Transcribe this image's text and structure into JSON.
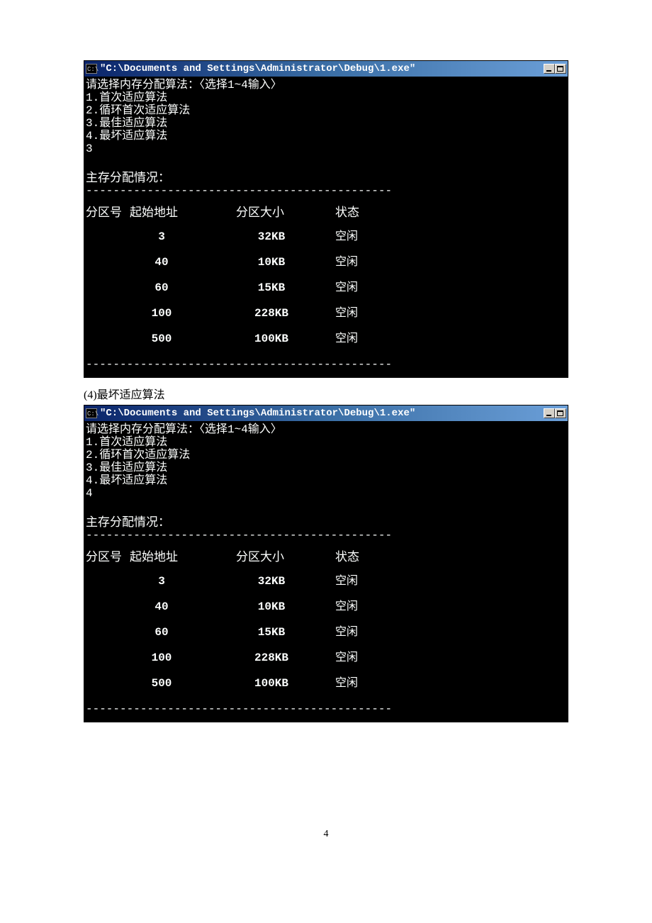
{
  "titlebar": {
    "icon_label": "C:\\",
    "title": "\"C:\\Documents and Settings\\Administrator\\Debug\\1.exe\""
  },
  "console1": {
    "prompt": "请选择内存分配算法：〈选择1~4输入〉",
    "opt1": "1.首次适应算法",
    "opt2": "2.循环首次适应算法",
    "opt3": "3.最佳适应算法",
    "opt4": "4.最坏适应算法",
    "input": "3",
    "section": "主存分配情况：",
    "hr": "---------------------------------------------",
    "headers": {
      "id": "分区号",
      "addr": "起始地址",
      "size": "分区大小",
      "state": "状态"
    },
    "rows": [
      {
        "id": "",
        "addr": "3",
        "size": "32KB",
        "state": "空闲"
      },
      {
        "id": "",
        "addr": "40",
        "size": "10KB",
        "state": "空闲"
      },
      {
        "id": "",
        "addr": "60",
        "size": "15KB",
        "state": "空闲"
      },
      {
        "id": "",
        "addr": "100",
        "size": "228KB",
        "state": "空闲"
      },
      {
        "id": "",
        "addr": "500",
        "size": "100KB",
        "state": "空闲"
      }
    ]
  },
  "caption": "(4)最坏适应算法",
  "console2": {
    "prompt": "请选择内存分配算法：〈选择1~4输入〉",
    "opt1": "1.首次适应算法",
    "opt2": "2.循环首次适应算法",
    "opt3": "3.最佳适应算法",
    "opt4": "4.最坏适应算法",
    "input": "4",
    "section": "主存分配情况：",
    "hr": "---------------------------------------------",
    "headers": {
      "id": "分区号",
      "addr": "起始地址",
      "size": "分区大小",
      "state": "状态"
    },
    "rows": [
      {
        "id": "",
        "addr": "3",
        "size": "32KB",
        "state": "空闲"
      },
      {
        "id": "",
        "addr": "40",
        "size": "10KB",
        "state": "空闲"
      },
      {
        "id": "",
        "addr": "60",
        "size": "15KB",
        "state": "空闲"
      },
      {
        "id": "",
        "addr": "100",
        "size": "228KB",
        "state": "空闲"
      },
      {
        "id": "",
        "addr": "500",
        "size": "100KB",
        "state": "空闲"
      }
    ]
  },
  "page_number": "4"
}
